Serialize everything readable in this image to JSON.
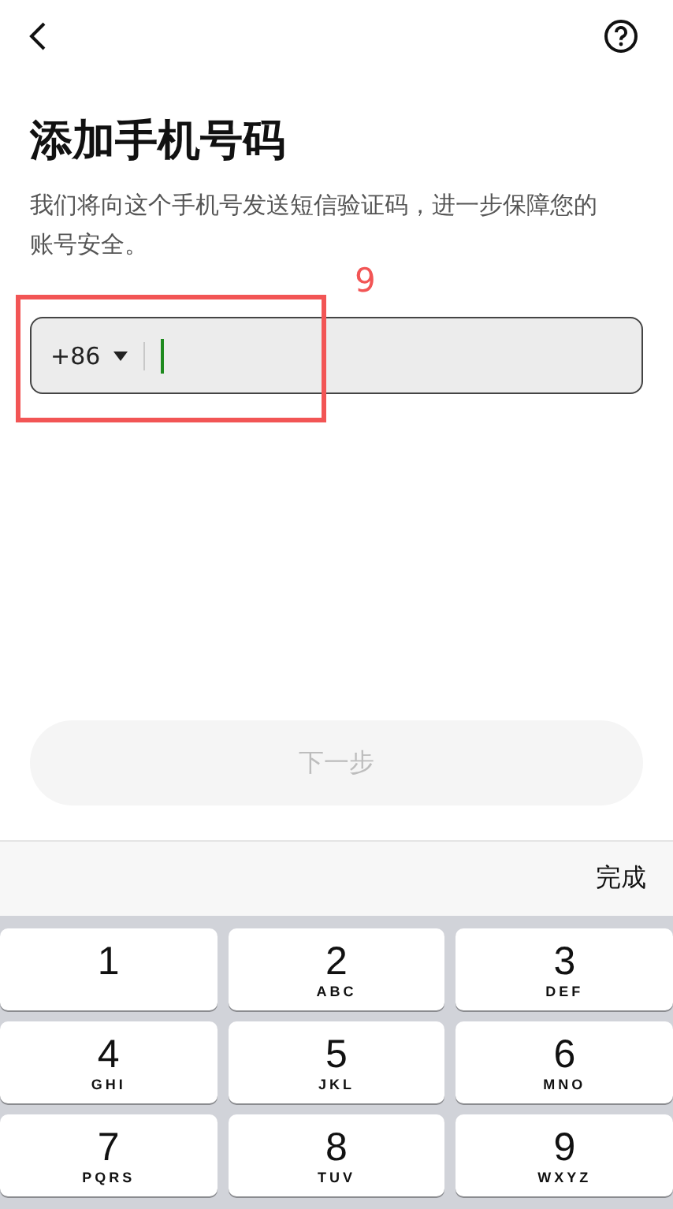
{
  "title": "添加手机号码",
  "description": "我们将向这个手机号发送短信验证码，进一步保障您的账号安全。",
  "annotation": {
    "label": "9"
  },
  "phone_field": {
    "country_code": "+86",
    "focused": true
  },
  "next_button": {
    "label": "下一步",
    "disabled": true
  },
  "keyboard": {
    "done": "完成",
    "keys": [
      {
        "digit": "1"
      },
      {
        "digit": "2",
        "letters": "ABC"
      },
      {
        "digit": "3",
        "letters": "DEF"
      },
      {
        "digit": "4",
        "letters": "GHI"
      },
      {
        "digit": "5",
        "letters": "JKL"
      },
      {
        "digit": "6",
        "letters": "MNO"
      },
      {
        "digit": "7",
        "letters": "PQRS"
      },
      {
        "digit": "8",
        "letters": "TUV"
      },
      {
        "digit": "9",
        "letters": "WXYZ"
      }
    ]
  }
}
